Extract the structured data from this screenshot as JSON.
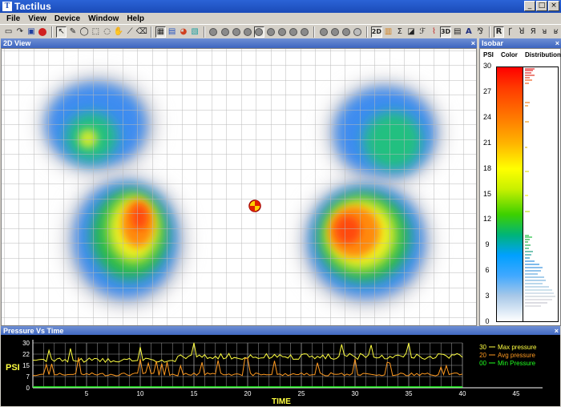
{
  "window": {
    "title": "Tactilus",
    "app_icon": "T",
    "min": "_",
    "max": "□",
    "close": "×"
  },
  "menu": [
    "File",
    "View",
    "Device",
    "Window",
    "Help"
  ],
  "toolbar": {
    "btn_2d": "2D",
    "btn_3d": "3D",
    "btn_a": "A",
    "btn_r": "R"
  },
  "view2d": {
    "title": "2D View",
    "close": "×"
  },
  "isobar": {
    "title": "Isobar",
    "close": "×",
    "col_psi": "PSI",
    "col_color": "Color",
    "col_distribution": "Distribution",
    "ticks": [
      "30",
      "27",
      "24",
      "21",
      "18",
      "15",
      "12",
      "9",
      "6",
      "3",
      "0"
    ]
  },
  "pvt": {
    "title": "Pressure Vs Time",
    "close": "×",
    "ylabel": "PSI",
    "xlabel": "TIME",
    "y_ticks": [
      "30",
      "22",
      "15",
      "7",
      "0"
    ],
    "x_ticks": [
      "5",
      "10",
      "15",
      "20",
      "25",
      "30",
      "35",
      "40",
      "45"
    ],
    "legend": [
      {
        "value": "30",
        "label": "Max pressure",
        "color": "#ffff40"
      },
      {
        "value": "20",
        "label": "Avg pressure",
        "color": "#ff9a20"
      },
      {
        "value": "00",
        "label": "Min Pressure",
        "color": "#20ff20"
      }
    ]
  },
  "colors": {
    "max": "#ffff40",
    "avg": "#ff9a20",
    "min": "#20ff20",
    "panel_head": "#3d65c0"
  }
}
